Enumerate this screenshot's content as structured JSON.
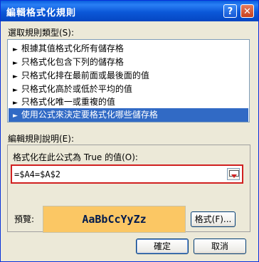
{
  "window": {
    "title": "編輯格式化規則",
    "help_label": "?",
    "close_label": "✕"
  },
  "rule_type": {
    "label": "選取規則類型(S):",
    "items": [
      "根據其值格式化所有儲存格",
      "只格式化包含下列的儲存格",
      "只格式化排在最前面或最後面的值",
      "只格式化高於或低於平均的值",
      "只格式化唯一或重複的值",
      "使用公式來決定要格式化哪些儲存格"
    ],
    "selected_index": 5,
    "bullet": "►"
  },
  "edit_rule": {
    "label": "編輯規則說明(E):",
    "formula_label": "格式化在此公式為 True 的值(O):",
    "formula_value": "=$A4=$A$2",
    "preview_label": "預覽:",
    "preview_text": "AaBbCcYyZz",
    "format_button": "格式(F)..."
  },
  "buttons": {
    "ok": "確定",
    "cancel": "取消"
  },
  "colors": {
    "selection": "#316ac5",
    "preview_fill": "#fbc764",
    "highlight_border": "#d02020"
  }
}
